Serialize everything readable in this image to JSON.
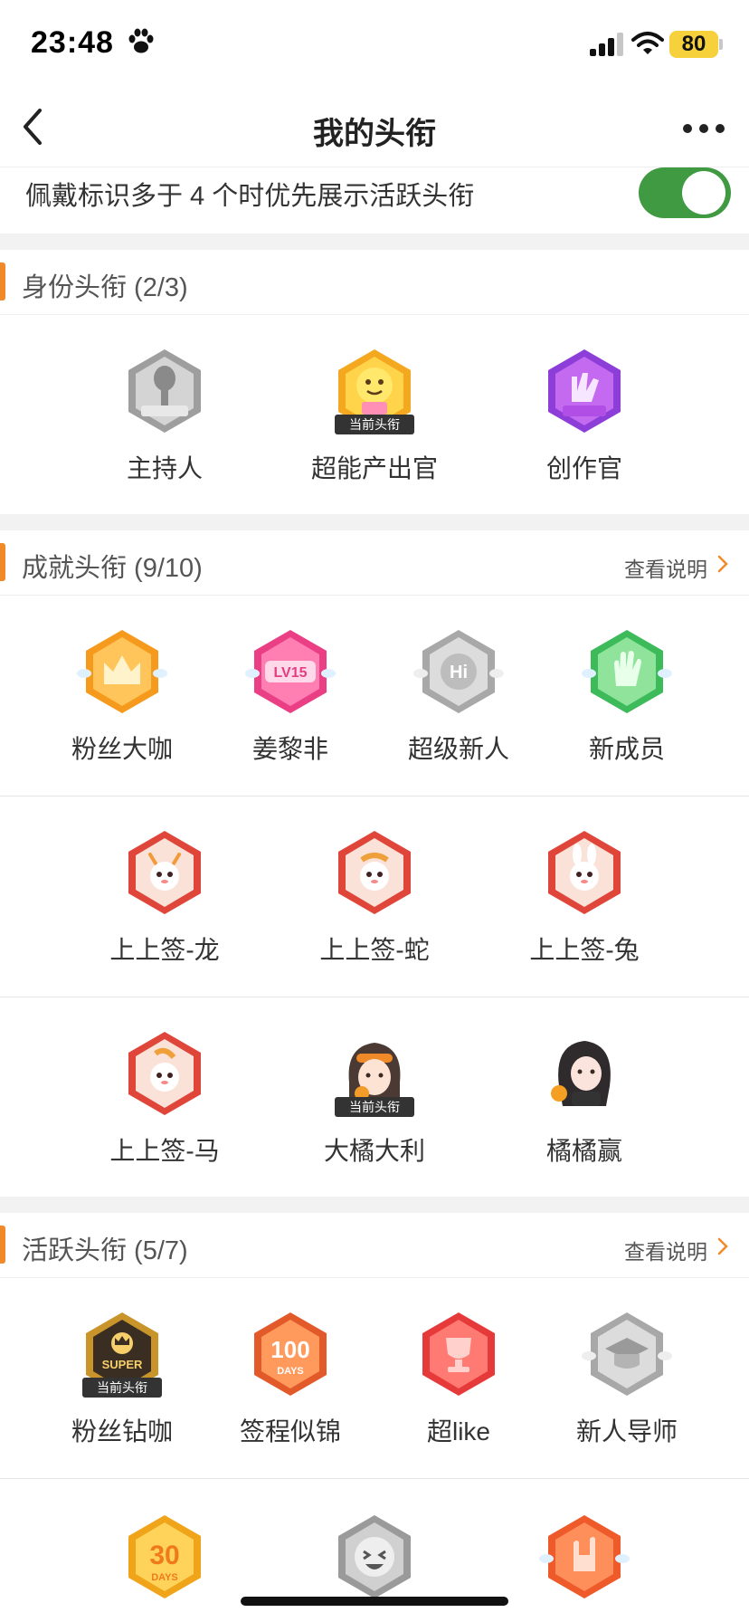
{
  "status_bar": {
    "time": "23:48",
    "battery": "80"
  },
  "nav": {
    "title": "我的头衔"
  },
  "toggle_row": {
    "text": "佩戴标识多于 4 个时优先展示活跃头衔",
    "enabled": true
  },
  "identity": {
    "title": "身份头衔 (2/3)",
    "badges": [
      {
        "label": "主持人",
        "icon": "host-badge-icon",
        "current": false
      },
      {
        "label": "超能产出官",
        "icon": "super-producer-badge-icon",
        "current": true
      },
      {
        "label": "创作官",
        "icon": "creator-badge-icon",
        "current": false
      }
    ]
  },
  "achievement": {
    "title": "成就头衔 (9/10)",
    "link": "查看说明",
    "badges": [
      {
        "label": "粉丝大咖",
        "icon": "crown-badge-icon"
      },
      {
        "label": "姜黎非",
        "icon": "lv15-badge-icon"
      },
      {
        "label": "超级新人",
        "icon": "hi-badge-icon"
      },
      {
        "label": "新成员",
        "icon": "hand-badge-icon"
      },
      {
        "label": "上上签-龙",
        "icon": "dragon-badge-icon"
      },
      {
        "label": "上上签-蛇",
        "icon": "snake-badge-icon"
      },
      {
        "label": "上上签-兔",
        "icon": "rabbit-badge-icon"
      },
      {
        "label": "上上签-马",
        "icon": "horse-badge-icon"
      },
      {
        "label": "大橘大利",
        "icon": "orange-girl-badge-icon",
        "current": true
      },
      {
        "label": "橘橘赢",
        "icon": "orange-girl2-badge-icon"
      }
    ]
  },
  "active": {
    "title": "活跃头衔 (5/7)",
    "link": "查看说明",
    "badges": [
      {
        "label": "粉丝钻咖",
        "icon": "super-crown-badge-icon",
        "current": true
      },
      {
        "label": "签程似锦",
        "icon": "100-days-badge-icon"
      },
      {
        "label": "超like",
        "icon": "trophy-badge-icon"
      },
      {
        "label": "新人导师",
        "icon": "mentor-badge-icon"
      }
    ]
  },
  "current_tag": "当前头衔",
  "colors": {
    "accent": "#f08a28",
    "toggle_on": "#3f9a41"
  }
}
